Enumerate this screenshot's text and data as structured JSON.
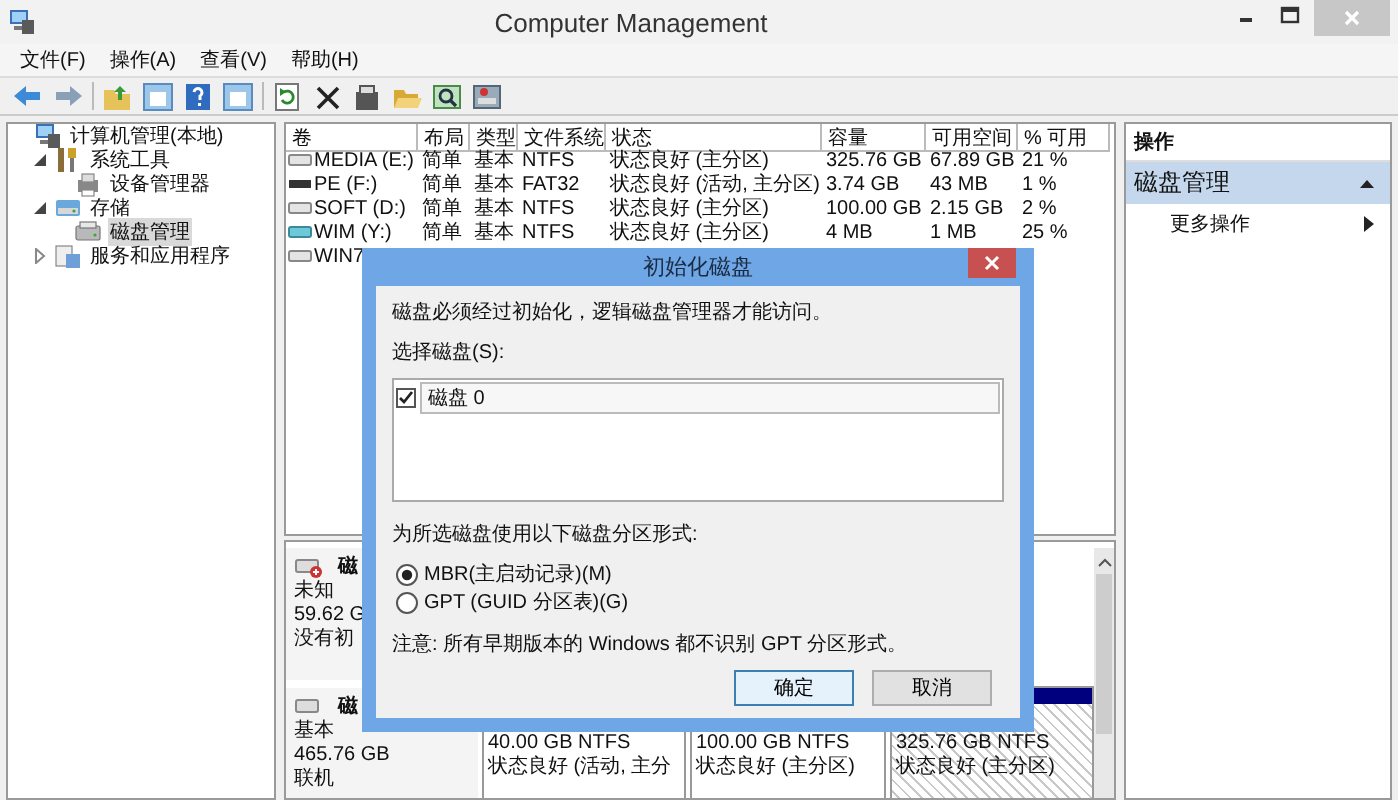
{
  "window": {
    "title": "Computer Management"
  },
  "menu": [
    "文件(F)",
    "操作(A)",
    "查看(V)",
    "帮助(H)"
  ],
  "tree": [
    {
      "label": "计算机管理(本地)",
      "selected": false,
      "children": [
        {
          "label": "系统工具",
          "expanded": true,
          "selected": false,
          "children": [
            {
              "label": "设备管理器",
              "selected": false
            }
          ]
        },
        {
          "label": "存储",
          "expanded": true,
          "selected": false,
          "children": [
            {
              "label": "磁盘管理",
              "selected": true
            }
          ]
        },
        {
          "label": "服务和应用程序",
          "expanded": false,
          "selected": false
        }
      ]
    }
  ],
  "volumes": {
    "columns": [
      "卷",
      "布局",
      "类型",
      "文件系统",
      "状态",
      "容量",
      "可用空间",
      "% 可用"
    ],
    "rows": [
      {
        "cells": [
          "MEDIA (E:)",
          "简单",
          "基本",
          "NTFS",
          "状态良好 (主分区)",
          "325.76 GB",
          "67.89 GB",
          "21 %"
        ],
        "kind": "hdd"
      },
      {
        "cells": [
          "PE (F:)",
          "简单",
          "基本",
          "FAT32",
          "状态良好 (活动, 主分区)",
          "3.74 GB",
          "43 MB",
          "1 %"
        ],
        "kind": "removable"
      },
      {
        "cells": [
          "SOFT (D:)",
          "简单",
          "基本",
          "NTFS",
          "状态良好 (主分区)",
          "100.00 GB",
          "2.15 GB",
          "2 %"
        ],
        "kind": "hdd"
      },
      {
        "cells": [
          "WIM (Y:)",
          "简单",
          "基本",
          "NTFS",
          "状态良好 (主分区)",
          "4 MB",
          "1 MB",
          "25 %"
        ],
        "kind": "image"
      },
      {
        "cells": [
          "WIN7"
        ],
        "kind": "hdd"
      }
    ]
  },
  "disks": [
    {
      "name": "磁",
      "kind": "unknown",
      "lines": [
        "未知",
        "59.62 G",
        "没有初"
      ]
    },
    {
      "name": "磁",
      "kind": "basic",
      "lines": [
        "基本",
        "465.76 GB",
        "联机"
      ],
      "partitions": [
        {
          "size": "40.00 GB NTFS",
          "status": "状态良好 (活动, 主分",
          "kind": "plain"
        },
        {
          "size": "100.00 GB NTFS",
          "status": "状态良好 (主分区)",
          "kind": "plain"
        },
        {
          "size": "325.76 GB NTFS",
          "status": "状态良好 (主分区)",
          "kind": "hatched"
        }
      ]
    }
  ],
  "actions": {
    "title": "操作",
    "items": [
      {
        "label": "磁盘管理",
        "kind": "group"
      },
      {
        "label": "更多操作",
        "kind": "submenu"
      }
    ]
  },
  "dialog": {
    "title": "初始化磁盘",
    "message": "磁盘必须经过初始化，逻辑磁盘管理器才能访问。",
    "select_label": "选择磁盘(S):",
    "disks": [
      {
        "label": "磁盘 0",
        "checked": true
      }
    ],
    "style_label": "为所选磁盘使用以下磁盘分区形式:",
    "options": [
      {
        "label": "MBR(主启动记录)(M)",
        "selected": true
      },
      {
        "label": "GPT (GUID 分区表)(G)",
        "selected": false
      }
    ],
    "note": "注意: 所有早期版本的 Windows 都不识别 GPT 分区形式。",
    "buttons": [
      {
        "label": "确定",
        "default": true
      },
      {
        "label": "取消",
        "default": false
      }
    ]
  }
}
